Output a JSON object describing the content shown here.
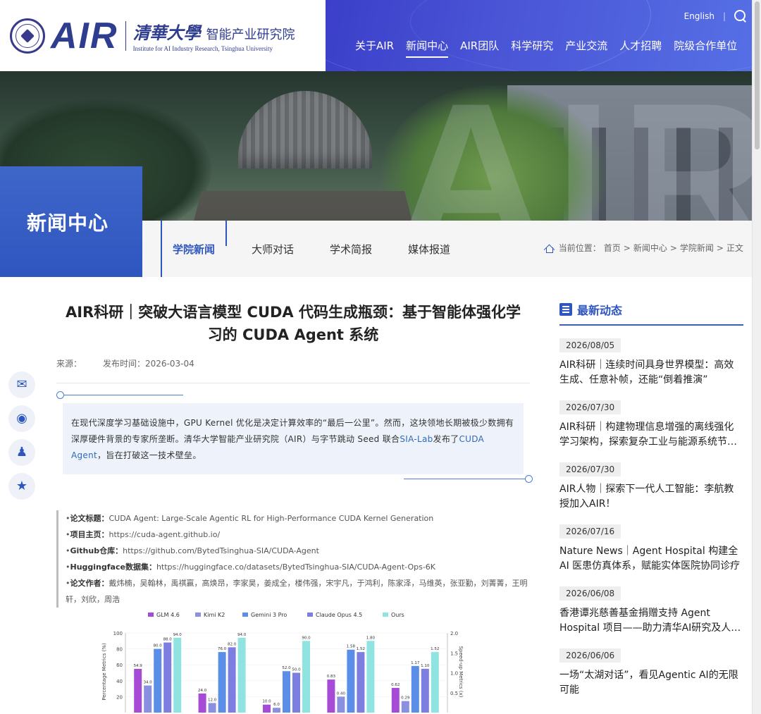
{
  "header": {
    "logo_mark": "AIR",
    "logo_cn_script": "清華大學",
    "logo_cn_institute": "智能产业研究院",
    "logo_en": "Institute for AI Industry Research, Tsinghua University",
    "lang_link": "English",
    "lang_sep": "|",
    "nav": [
      {
        "label": "关于AIR"
      },
      {
        "label": "新闻中心"
      },
      {
        "label": "AIR团队"
      },
      {
        "label": "科学研究"
      },
      {
        "label": "产业交流"
      },
      {
        "label": "人才招聘"
      },
      {
        "label": "院级合作单位"
      }
    ],
    "active_nav": "新闻中心"
  },
  "banner": {
    "watermark": "AIR",
    "section_title": "新闻中心",
    "tabs": [
      {
        "label": "学院新闻"
      },
      {
        "label": "大师对话"
      },
      {
        "label": "学术简报"
      },
      {
        "label": "媒体报道"
      }
    ],
    "breadcrumb": {
      "prefix": "当前位置：",
      "items": [
        "首页",
        "新闻中心",
        "学院新闻",
        "正文"
      ],
      "sep": ">"
    }
  },
  "article": {
    "title": "AIR科研｜突破大语言模型 CUDA 代码生成瓶颈：基于智能体强化学习的 CUDA Agent 系统",
    "source_label": "来源：",
    "source_value": "",
    "date_label": "发布时间：",
    "date_value": "2026-03-04",
    "intro_part1": "在现代深度学习基础设施中，GPU Kernel 优化是决定计算效率的“最后一公里”。然而，这块领地长期被极少数拥有深厚硬件背景的专家所垄断。清华大学智能产业研究院（AIR）与字节跳动 Seed 联合",
    "intro_link1": "SIA-Lab",
    "intro_part2": "发布了",
    "intro_link2": "CUDA Agent",
    "intro_part3": "，旨在打破这一技术壁垒。",
    "paper": [
      {
        "key": "论文标题：",
        "value": "CUDA Agent: Large-Scale Agentic RL for High-Performance CUDA Kernel Generation"
      },
      {
        "key": "项目主页：",
        "value": "https://cuda-agent.github.io/"
      },
      {
        "key": "Github仓库：",
        "value": "https://github.com/BytedTsinghua-SIA/CUDA-Agent"
      },
      {
        "key": "Huggingface数据集：",
        "value": "https://huggingface.co/datasets/BytedTsinghua-SIA/CUDA-Agent-Ops-6K"
      },
      {
        "key": "论文作者：",
        "value": "戴炜楠，吴翰林，禹祺赢，高焕昂，李家昊，姜成全，楼伟强，宋宇凡，于鸿利，陈家泽，马维英，张亚勤，刘菁菁，王明轩，刘欣，周浩"
      }
    ]
  },
  "chart_data": {
    "type": "bar",
    "legend": [
      "GLM 4.6",
      "Kimi K2",
      "Gemini 3 Pro",
      "Claude Opus 4.5",
      "Ours"
    ],
    "colors": [
      "#a64bd6",
      "#8a8fe0",
      "#5b8ee6",
      "#7d7fe0",
      "#8fe3e0"
    ],
    "ylabel_left": "Percentage Metrics (%)",
    "ylabel_right": "Speed-up Metrics (x)",
    "y_ticks_left": [
      "100",
      "80",
      "60",
      "40",
      "20"
    ],
    "y_ticks_right": [
      "2.0",
      "1.5",
      "1.0",
      "0.5"
    ],
    "ylim_left": [
      0,
      100
    ],
    "ylim_right": [
      0,
      2.0
    ],
    "axis": [
      "left",
      "left",
      "left",
      "right",
      "right"
    ],
    "groups": [
      {
        "values": [
          54.9,
          34.0,
          80.0,
          88.0,
          94.0
        ],
        "labels": [
          "54.9",
          "34.0",
          "80.0",
          "88.0",
          "94.0"
        ]
      },
      {
        "values": [
          24.0,
          12.0,
          76.0,
          82.0,
          94.0
        ],
        "labels": [
          "24.0",
          "12.0",
          "76.0",
          "82.0",
          "94.0"
        ]
      },
      {
        "values": [
          10.0,
          6.0,
          52.0,
          50.0,
          90.0
        ],
        "labels": [
          "10.0",
          "6.0",
          "52.0",
          "50.0",
          "90.0"
        ]
      },
      {
        "values": [
          0.83,
          0.4,
          1.58,
          1.52,
          1.8
        ],
        "labels": [
          "0.83",
          "0.40",
          "1.58",
          "1.52",
          "1.80"
        ]
      },
      {
        "values": [
          0.62,
          0.29,
          1.17,
          1.1,
          1.52
        ],
        "labels": [
          "0.62",
          "0.29",
          "1.17",
          "1.10",
          "1.52"
        ]
      }
    ]
  },
  "sidebar": {
    "title": "最新动态",
    "items": [
      {
        "date": "2026/08/05",
        "title": "AIR科研｜连续时间具身世界模型：高效生成、任意补帧，还能“倒着推演”"
      },
      {
        "date": "2026/07/30",
        "title": "AIR科研｜构建物理信息增强的离线强化学习架构，探索复杂工业与能源系统节能优化"
      },
      {
        "date": "2026/07/30",
        "title": "AIR人物｜探索下一代人工智能：李航教授加入AIR！"
      },
      {
        "date": "2026/07/16",
        "title": "Nature News｜Agent Hospital 构建全 AI 医患仿真体系，赋能实体医院协同诊疗"
      },
      {
        "date": "2026/06/08",
        "title": "香港谭兆慈善基金捐赠支持 Agent Hospital 项目——助力清华AI研究及人才培养"
      },
      {
        "date": "2026/06/06",
        "title": "一场“太湖对话”，看见Agentic AI的无限可能"
      }
    ]
  },
  "share": {
    "icons": [
      "wechat-icon",
      "weibo-icon",
      "qq-icon",
      "favorite-icon"
    ]
  },
  "colors": {
    "brand": "#2e56bf",
    "nav_gradient_start": "#3b3fc9",
    "nav_gradient_end": "#5670e6",
    "intro_bg": "#eef3fb"
  }
}
